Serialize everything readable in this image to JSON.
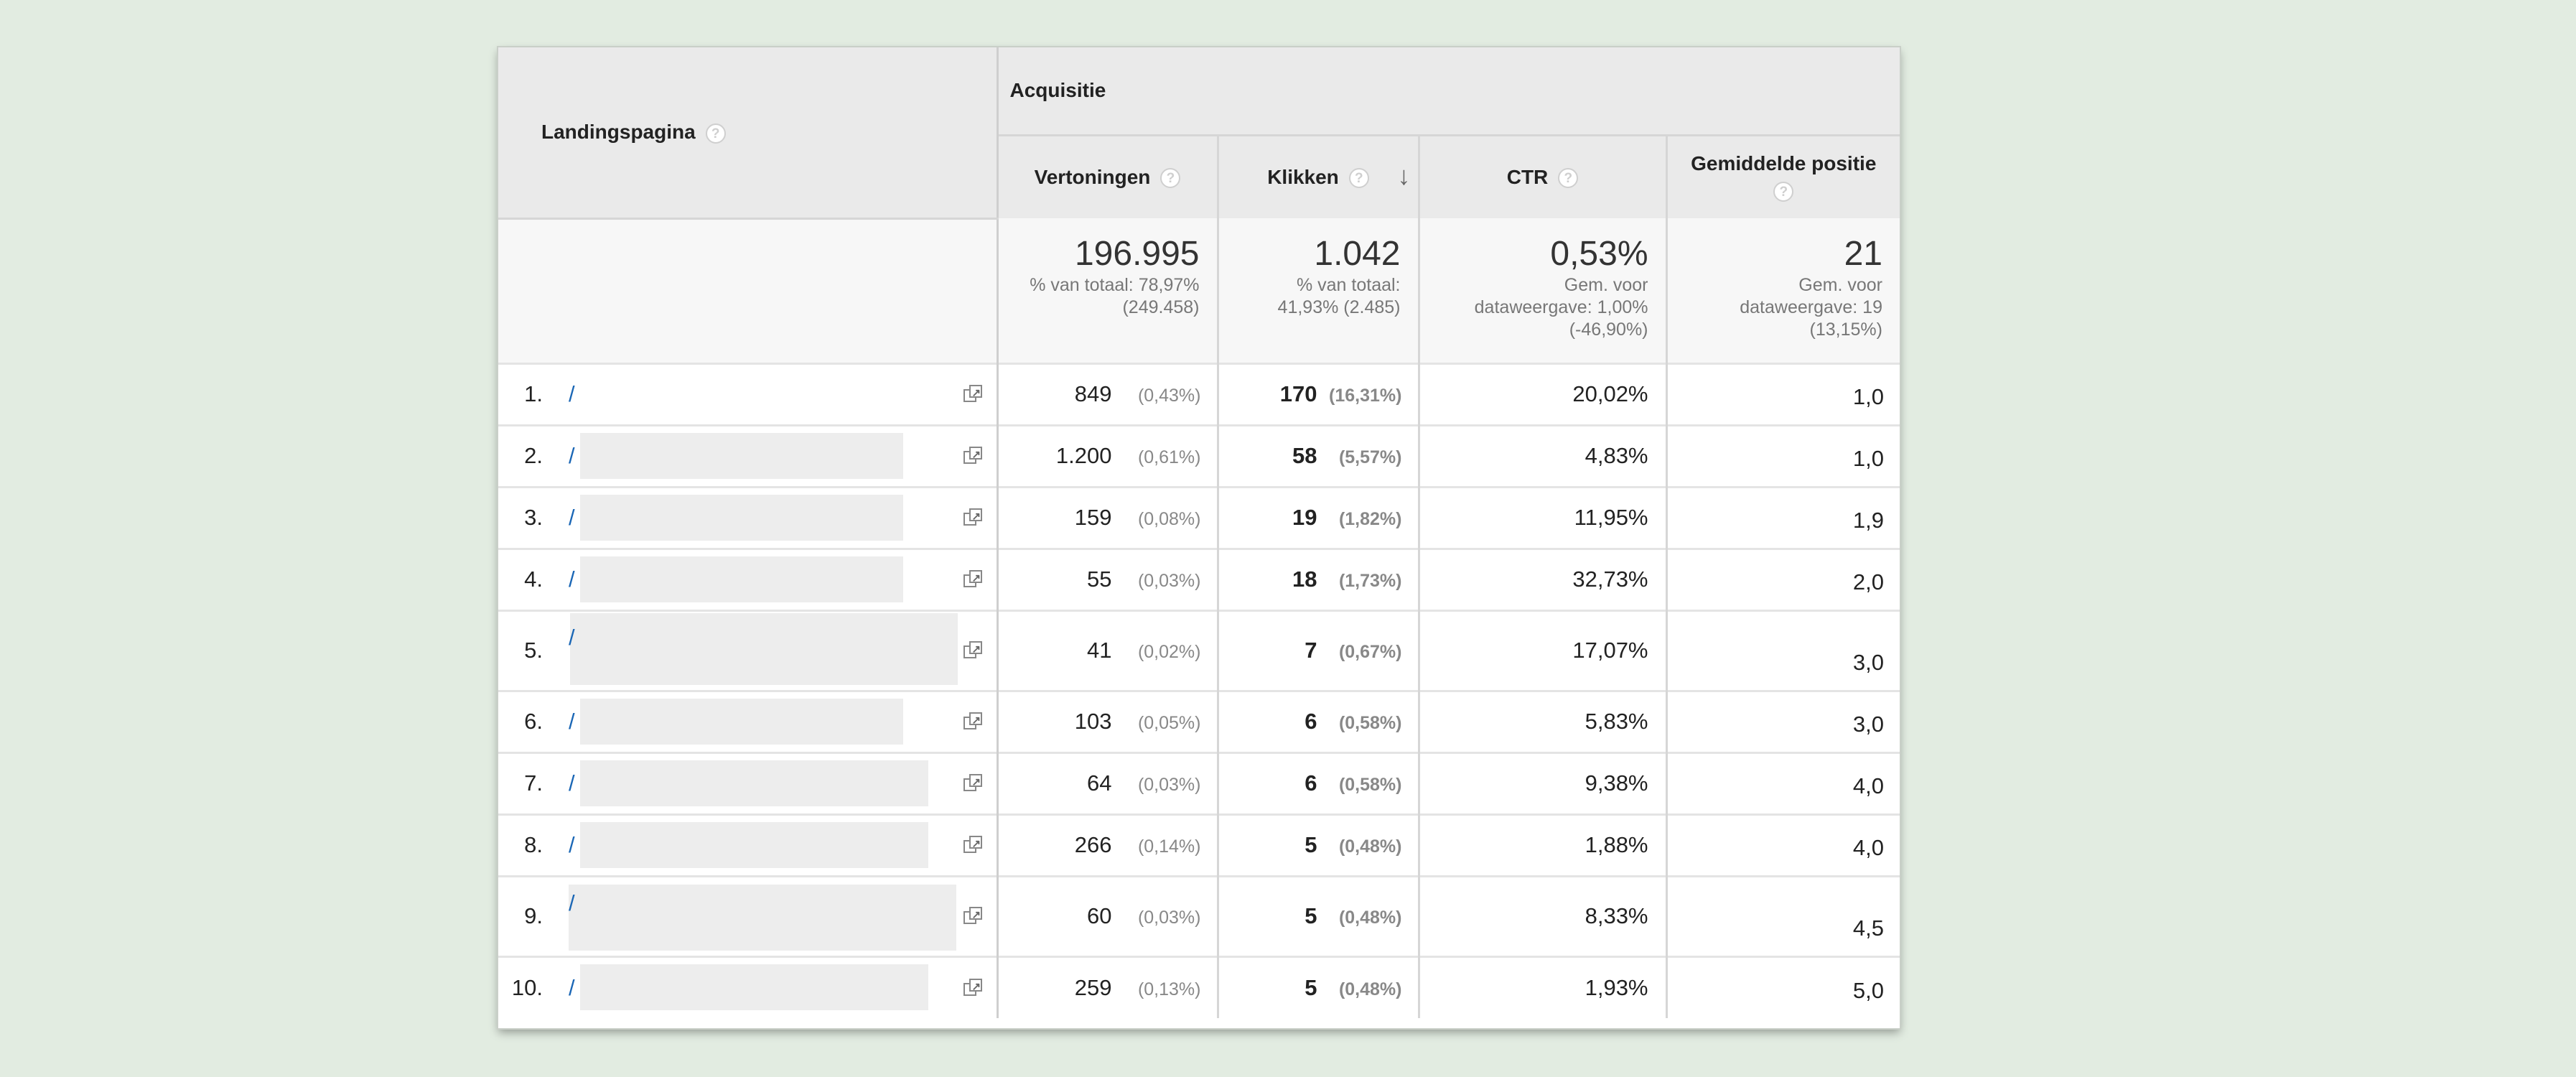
{
  "table": {
    "headers": {
      "landing_page": "Landingspagina",
      "group": "Acquisitie",
      "impressions": "Vertoningen",
      "clicks": "Klikken",
      "ctr": "CTR",
      "avg_position": "Gemiddelde positie",
      "help_glyph": "?"
    },
    "totals": {
      "impressions": "196.995",
      "impressions_sub1": "% van totaal: 78,97%",
      "impressions_sub2": "(249.458)",
      "clicks": "1.042",
      "clicks_sub1": "% van totaal:",
      "clicks_sub2": "41,93% (2.485)",
      "ctr": "0,53%",
      "ctr_sub1": "Gem. voor",
      "ctr_sub2": "dataweergave: 1,00%",
      "ctr_sub3": "(-46,90%)",
      "position": "21",
      "position_sub1": "Gem. voor",
      "position_sub2": "dataweergave: 19",
      "position_sub3": "(13,15%)"
    },
    "rows": [
      {
        "index": "1.",
        "page": "/",
        "impressions": "849",
        "impressions_pct": "(0,43%)",
        "clicks": "170",
        "clicks_pct": "(16,31%)",
        "ctr": "20,02%",
        "position": "1,0"
      },
      {
        "index": "2.",
        "page": "/",
        "impressions": "1.200",
        "impressions_pct": "(0,61%)",
        "clicks": "58",
        "clicks_pct": "(5,57%)",
        "ctr": "4,83%",
        "position": "1,0"
      },
      {
        "index": "3.",
        "page": "/",
        "impressions": "159",
        "impressions_pct": "(0,08%)",
        "clicks": "19",
        "clicks_pct": "(1,82%)",
        "ctr": "11,95%",
        "position": "1,9"
      },
      {
        "index": "4.",
        "page": "/",
        "impressions": "55",
        "impressions_pct": "(0,03%)",
        "clicks": "18",
        "clicks_pct": "(1,73%)",
        "ctr": "32,73%",
        "position": "2,0"
      },
      {
        "index": "5.",
        "page": "/",
        "impressions": "41",
        "impressions_pct": "(0,02%)",
        "clicks": "7",
        "clicks_pct": "(0,67%)",
        "ctr": "17,07%",
        "position": "3,0"
      },
      {
        "index": "6.",
        "page": "/",
        "impressions": "103",
        "impressions_pct": "(0,05%)",
        "clicks": "6",
        "clicks_pct": "(0,58%)",
        "ctr": "5,83%",
        "position": "3,0"
      },
      {
        "index": "7.",
        "page": "/",
        "impressions": "64",
        "impressions_pct": "(0,03%)",
        "clicks": "6",
        "clicks_pct": "(0,58%)",
        "ctr": "9,38%",
        "position": "4,0"
      },
      {
        "index": "8.",
        "page": "/",
        "impressions": "266",
        "impressions_pct": "(0,14%)",
        "clicks": "5",
        "clicks_pct": "(0,48%)",
        "ctr": "1,88%",
        "position": "4,0"
      },
      {
        "index": "9.",
        "page": "/",
        "impressions": "60",
        "impressions_pct": "(0,03%)",
        "clicks": "5",
        "clicks_pct": "(0,48%)",
        "ctr": "8,33%",
        "position": "4,5"
      },
      {
        "index": "10.",
        "page": "/",
        "impressions": "259",
        "impressions_pct": "(0,13%)",
        "clicks": "5",
        "clicks_pct": "(0,48%)",
        "ctr": "1,93%",
        "position": "5,0"
      }
    ]
  }
}
